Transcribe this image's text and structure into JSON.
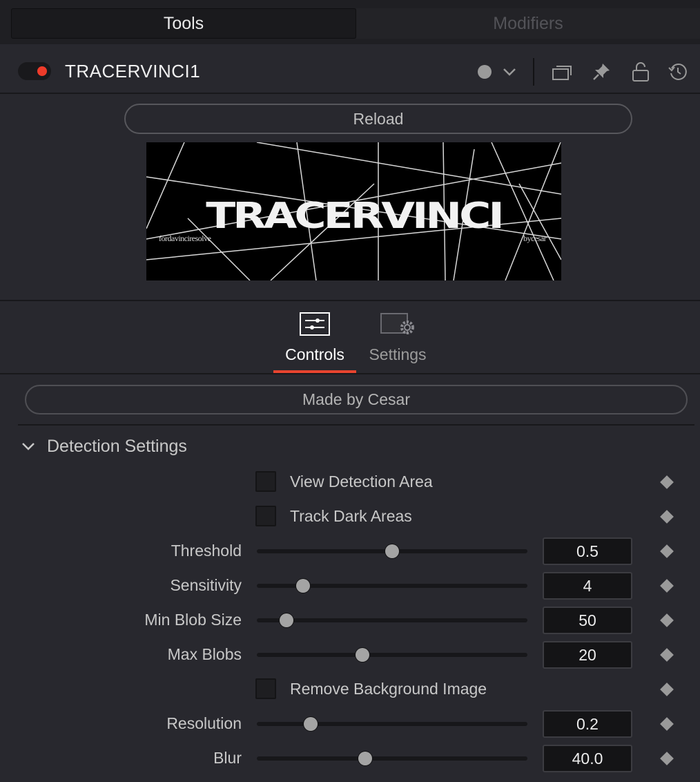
{
  "tabs": {
    "tools": "Tools",
    "modifiers": "Modifiers"
  },
  "node": {
    "name": "TRACERVINCI1",
    "toggle_color": "#ee3b2a"
  },
  "header_icons": [
    "circle-icon",
    "chevron-down-icon",
    "versions-icon",
    "pin-icon",
    "lock-icon",
    "reset-icon"
  ],
  "reload_label": "Reload",
  "preview": {
    "logo_text": "TRACERVINCI",
    "caption_left": "fordavinciresolve",
    "caption_right": "bycesar"
  },
  "control_tabs": [
    {
      "label": "Controls",
      "icon": "sliders-icon",
      "active": true
    },
    {
      "label": "Settings",
      "icon": "settings-gear-icon",
      "active": false
    }
  ],
  "made_by_label": "Made by Cesar",
  "section": {
    "title": "Detection Settings",
    "expanded": true
  },
  "controls": {
    "view_detection_area": {
      "label": "View Detection Area",
      "checked": false
    },
    "track_dark_areas": {
      "label": "Track Dark Areas",
      "checked": false
    },
    "threshold": {
      "label": "Threshold",
      "value": "0.5",
      "fraction": 0.5
    },
    "sensitivity": {
      "label": "Sensitivity",
      "value": "4",
      "fraction": 0.17
    },
    "min_blob_size": {
      "label": "Min Blob Size",
      "value": "50",
      "fraction": 0.11
    },
    "max_blobs": {
      "label": "Max Blobs",
      "value": "20",
      "fraction": 0.39
    },
    "remove_background_image": {
      "label": "Remove Background Image",
      "checked": false
    },
    "resolution": {
      "label": "Resolution",
      "value": "0.2",
      "fraction": 0.2
    },
    "blur": {
      "label": "Blur",
      "value": "40.0",
      "fraction": 0.4
    }
  },
  "colors": {
    "accent": "#e8442f",
    "panel": "#28282e",
    "field": "#141416"
  }
}
